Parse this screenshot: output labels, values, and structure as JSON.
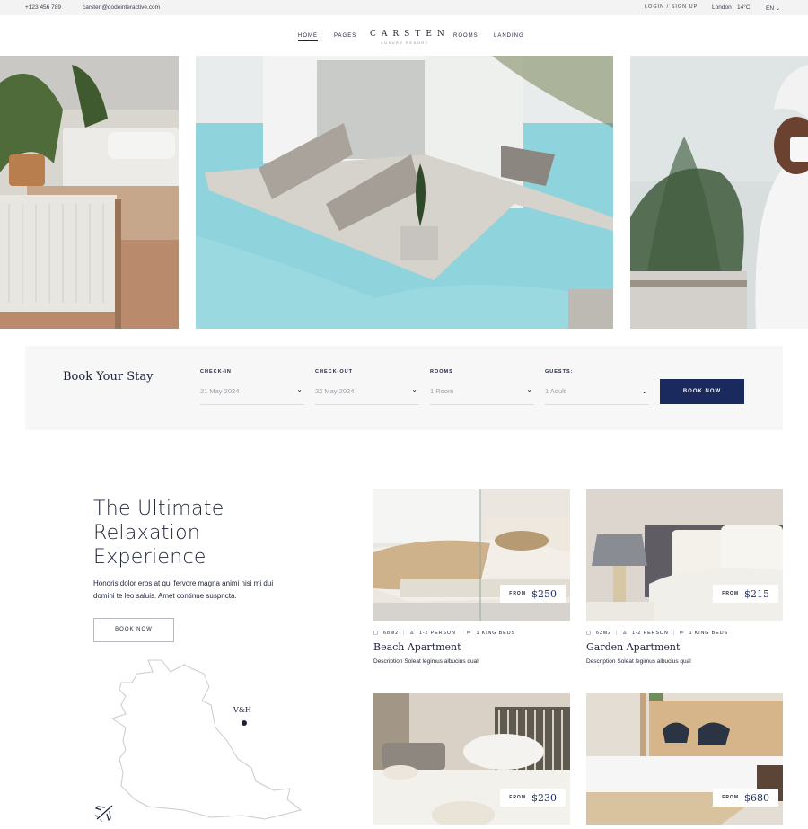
{
  "topbar": {
    "phone": "+123 456 789",
    "email": "carsten@qodeinteractive.com",
    "login": "LOGIN / SIGN UP",
    "city": "London",
    "temperature": "14°C",
    "language": "EN ⌄"
  },
  "nav": {
    "items": [
      "HOME",
      "PAGES",
      "ROOMS",
      "LANDING"
    ],
    "active": "HOME",
    "logo": "CARSTEN",
    "logo_sub": "LUXURY RESORT"
  },
  "booking": {
    "title": "Book Your Stay",
    "fields": [
      {
        "label": "CHECK-IN",
        "value": "21 May 2024"
      },
      {
        "label": "CHECK-OUT",
        "value": "22 May 2024"
      },
      {
        "label": "ROOMS",
        "value": "1 Room"
      },
      {
        "label": "GUESTS:",
        "value": "1 Adult"
      }
    ],
    "button": "BOOK NOW"
  },
  "intro": {
    "title_lines": [
      "The Ultimate",
      "Relaxation",
      "Experience"
    ],
    "text": "Honoris dolor eros at qui fervore magna animi nisi mi dui domini te leo saluis. Amet continue suspncta.",
    "button": "BOOK NOW"
  },
  "map": {
    "marker_label": "V&H"
  },
  "rooms": [
    {
      "name": "Beach Apartment",
      "from_label": "FROM",
      "price": "$250",
      "size": "68M2",
      "persons": "1-2 PERSON",
      "beds": "1 KING BEDS",
      "description": "Description Soleat legimus albucius qual"
    },
    {
      "name": "Garden Apartment",
      "from_label": "FROM",
      "price": "$215",
      "size": "63M2",
      "persons": "1-2 PERSON",
      "beds": "1 KING BEDS",
      "description": "Description Soleat legimus albucius qual"
    },
    {
      "name": "",
      "from_label": "FROM",
      "price": "$230"
    },
    {
      "name": "",
      "from_label": "FROM",
      "price": "$680"
    }
  ]
}
